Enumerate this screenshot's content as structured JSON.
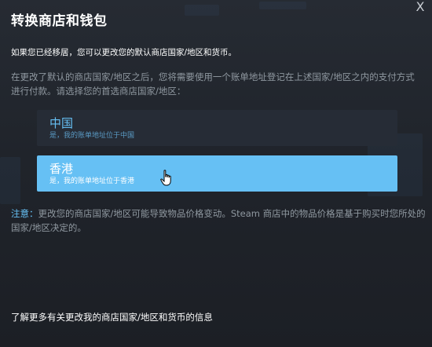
{
  "dialog": {
    "title": "转换商店和钱包",
    "close_symbol": "X",
    "intro": "如果您已经移居，您可以更改您的默认商店国家/地区和货币。",
    "description": "在更改了默认的商店国家/地区之后，您将需要使用一个账单地址登记在上述国家/地区之内的支付方式进行付款。请选择您的首选商店国家/地区：",
    "options": [
      {
        "name": "中国",
        "subtitle": "是，我的账单地址位于中国",
        "selected": false
      },
      {
        "name": "香港",
        "subtitle": "是，我的账单地址位于香港",
        "selected": true
      }
    ],
    "note_label": "注意：",
    "note_text": "更改您的商店国家/地区可能导致物品价格变动。Steam 商店中的物品价格是基于购买时您所处的国家/地区决定的。",
    "more_info_link": "了解更多有关更改我的商店国家/地区和货币的信息"
  },
  "colors": {
    "accent": "#66c0f4",
    "selected_bg": "#66c0f4",
    "option_bg": "#262c36",
    "text_muted": "#8f98a0"
  },
  "icons": {
    "close": "close-icon",
    "cursor": "hand-pointer-icon"
  }
}
